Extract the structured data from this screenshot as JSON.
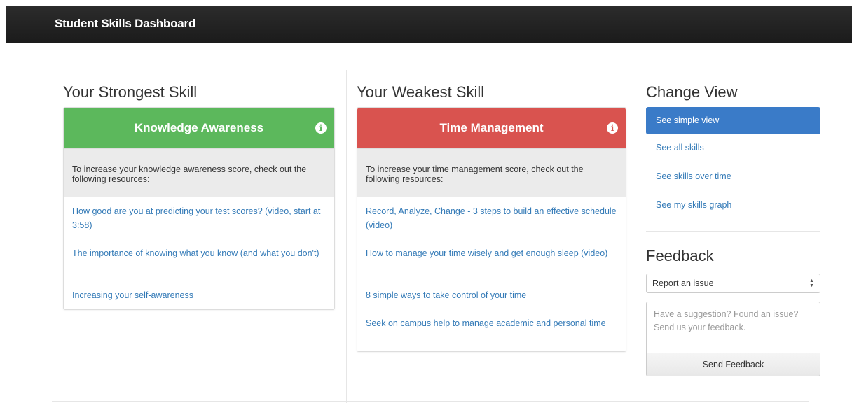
{
  "navbar": {
    "title": "Student Skills Dashboard"
  },
  "strongest": {
    "heading": "Your Strongest Skill",
    "skill": "Knowledge Awareness",
    "color": "#5cb85c",
    "intro": "To increase your knowledge awareness score, check out the following resources:",
    "resources": [
      "How good are you at predicting your test scores? (video, start at 3:58)",
      "The importance of knowing what you know (and what you don't)",
      "Increasing your self-awareness"
    ]
  },
  "weakest": {
    "heading": "Your Weakest Skill",
    "skill": "Time Management",
    "color": "#d9534f",
    "intro": "To increase your time management score, check out the following resources:",
    "resources": [
      "Record, Analyze, Change - 3 steps to build an effective schedule (video)",
      "How to manage your time wisely and get enough sleep (video)",
      "8 simple ways to take control of your time",
      "Seek on campus help to manage academic and personal time"
    ]
  },
  "change_view": {
    "heading": "Change View",
    "items": [
      "See simple view",
      "See all skills",
      "See skills over time",
      "See my skills graph"
    ],
    "active_index": 0
  },
  "feedback": {
    "heading": "Feedback",
    "select_value": "Report an issue",
    "textarea_placeholder": "Have a suggestion? Found an issue? Send us your feedback.",
    "send_label": "Send Feedback"
  },
  "icons": {
    "info": "info-circle-icon",
    "select": "select-arrows-icon"
  }
}
